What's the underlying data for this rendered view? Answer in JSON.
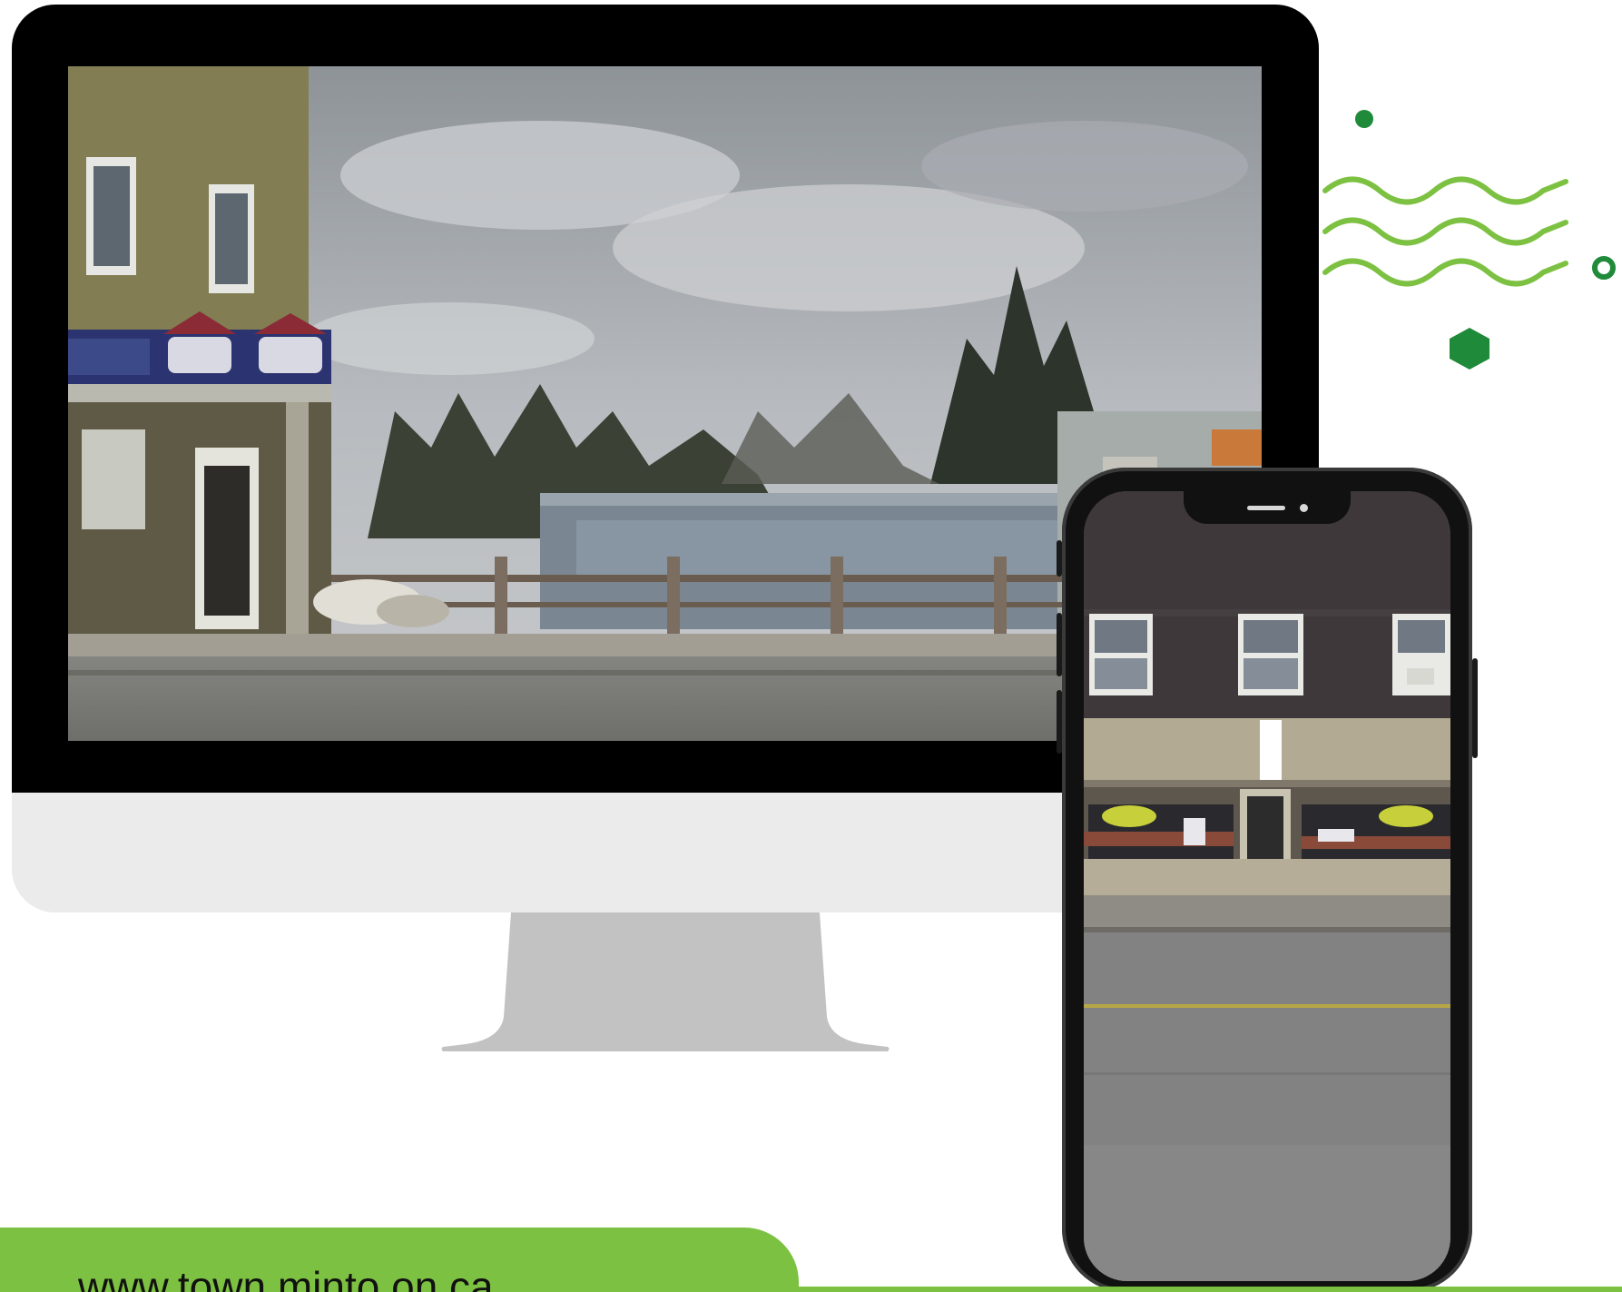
{
  "website_url": "www.town.minto.on.ca",
  "colors": {
    "accent_green": "#7dc142",
    "dark_green": "#1f8a3a",
    "monitor_bezel": "#000000",
    "monitor_chin": "#ebebeb",
    "stand": "#c2c2c2"
  },
  "monitor": {
    "screen_image": "street-view-corner-store-and-parking-lot"
  },
  "phone": {
    "screen_image": "street-view-storefront-with-windows"
  },
  "decorations": [
    "dot-icon",
    "wave-lines-icon",
    "ring-icon",
    "hexagon-icon"
  ]
}
